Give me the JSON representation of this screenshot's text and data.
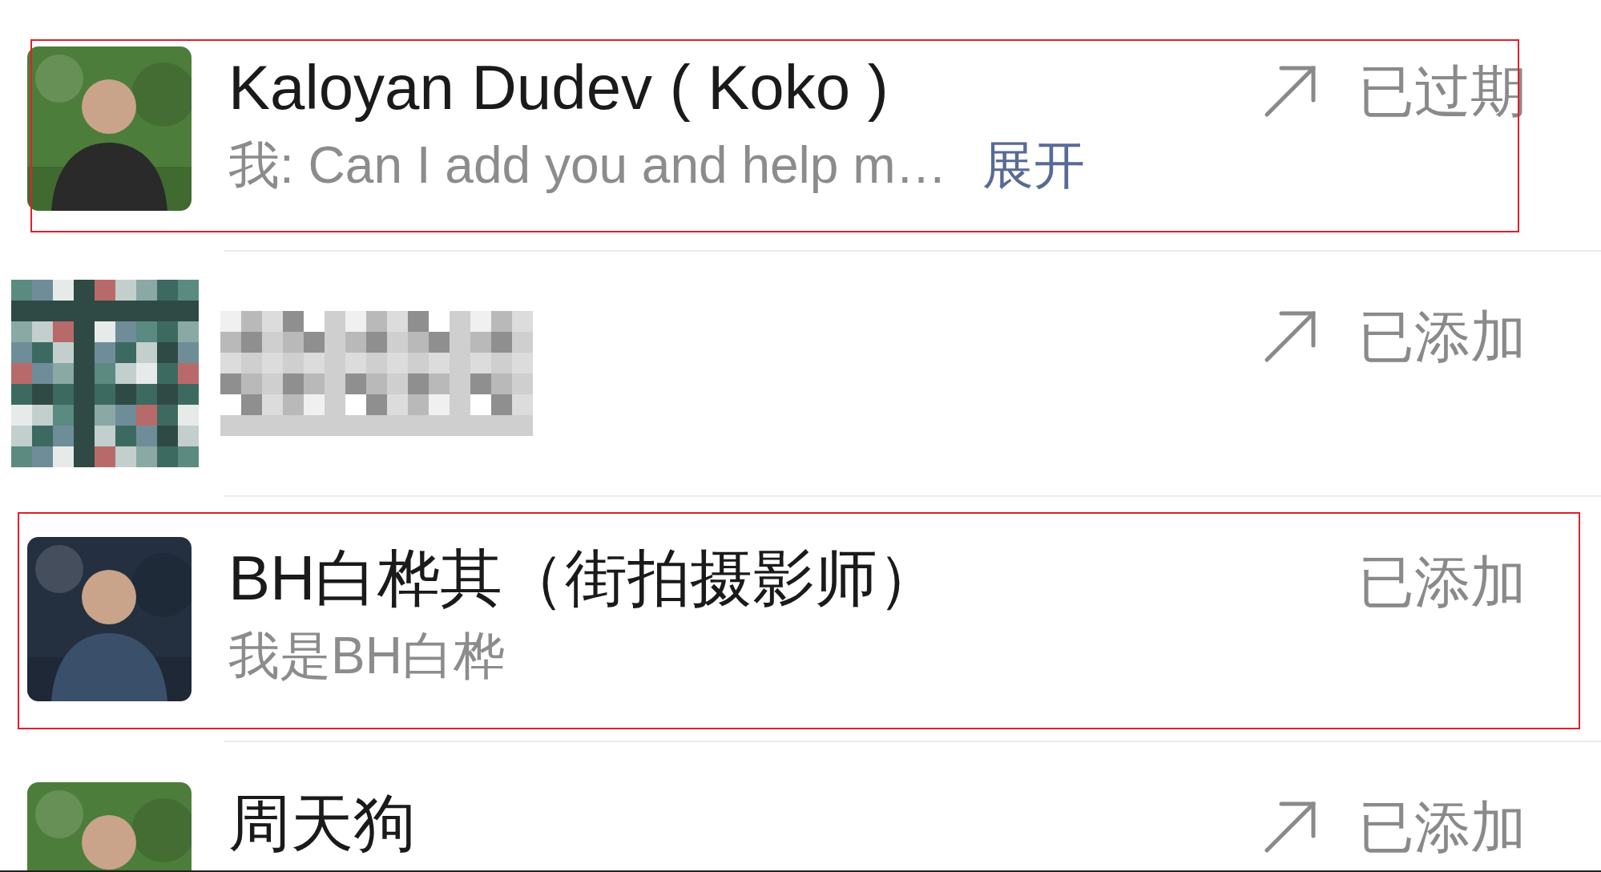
{
  "rows": [
    {
      "kind": "contact",
      "name": "Kaloyan Dudev ( Koko )",
      "message": "我: Can I add you and help m…",
      "expand_link": "展开",
      "forwarded": true,
      "status": "已过期",
      "highlighted": true
    },
    {
      "kind": "redacted",
      "forwarded": true,
      "status": "已添加",
      "highlighted": false
    },
    {
      "kind": "contact",
      "name": "BH白桦其（街拍摄影师）",
      "message": "我是BH白桦",
      "forwarded": false,
      "status": "已添加",
      "highlighted": true
    },
    {
      "kind": "contact",
      "name": "周天狗",
      "forwarded": true,
      "status": "已添加",
      "highlighted": false
    }
  ]
}
